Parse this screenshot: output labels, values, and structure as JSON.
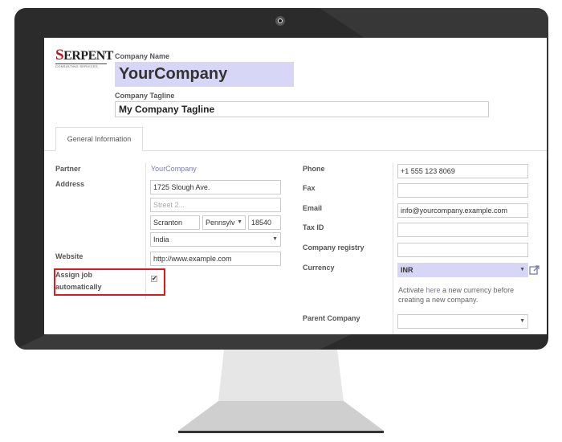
{
  "logo": {
    "main": "SERPENT",
    "sub": "CONSULTING SERVICES"
  },
  "company": {
    "name_label": "Company Name",
    "name": "YourCompany",
    "tagline_label": "Company Tagline",
    "tagline": "My Company Tagline"
  },
  "tabs": [
    {
      "label": "General Information"
    }
  ],
  "left": {
    "partner_label": "Partner",
    "partner_value": "YourCompany",
    "address_label": "Address",
    "street": "1725 Slough Ave.",
    "street2_placeholder": "Street 2...",
    "city": "Scranton",
    "state": "Pennsylv",
    "zip": "18540",
    "country": "India",
    "website_label": "Website",
    "website": "http://www.example.com",
    "assign_label_line1": "Assign job",
    "assign_label_line2": "automatically",
    "assign_checked": true
  },
  "right": {
    "phone_label": "Phone",
    "phone": "+1 555 123 8069",
    "fax_label": "Fax",
    "fax": "",
    "email_label": "Email",
    "email": "info@yourcompany.example.com",
    "taxid_label": "Tax ID",
    "taxid": "",
    "registry_label": "Company registry",
    "registry": "",
    "currency_label": "Currency",
    "currency": "INR",
    "help_before": "Activate ",
    "help_link": "here",
    "help_after": " a new currency before creating a new company.",
    "parent_label": "Parent Company",
    "parent": ""
  },
  "colors": {
    "highlight": "#d7d6f7",
    "link": "#7c7bad",
    "annotation": "#e0191c",
    "bezel": "#2b2b2b",
    "brand": "#b01c1c"
  }
}
